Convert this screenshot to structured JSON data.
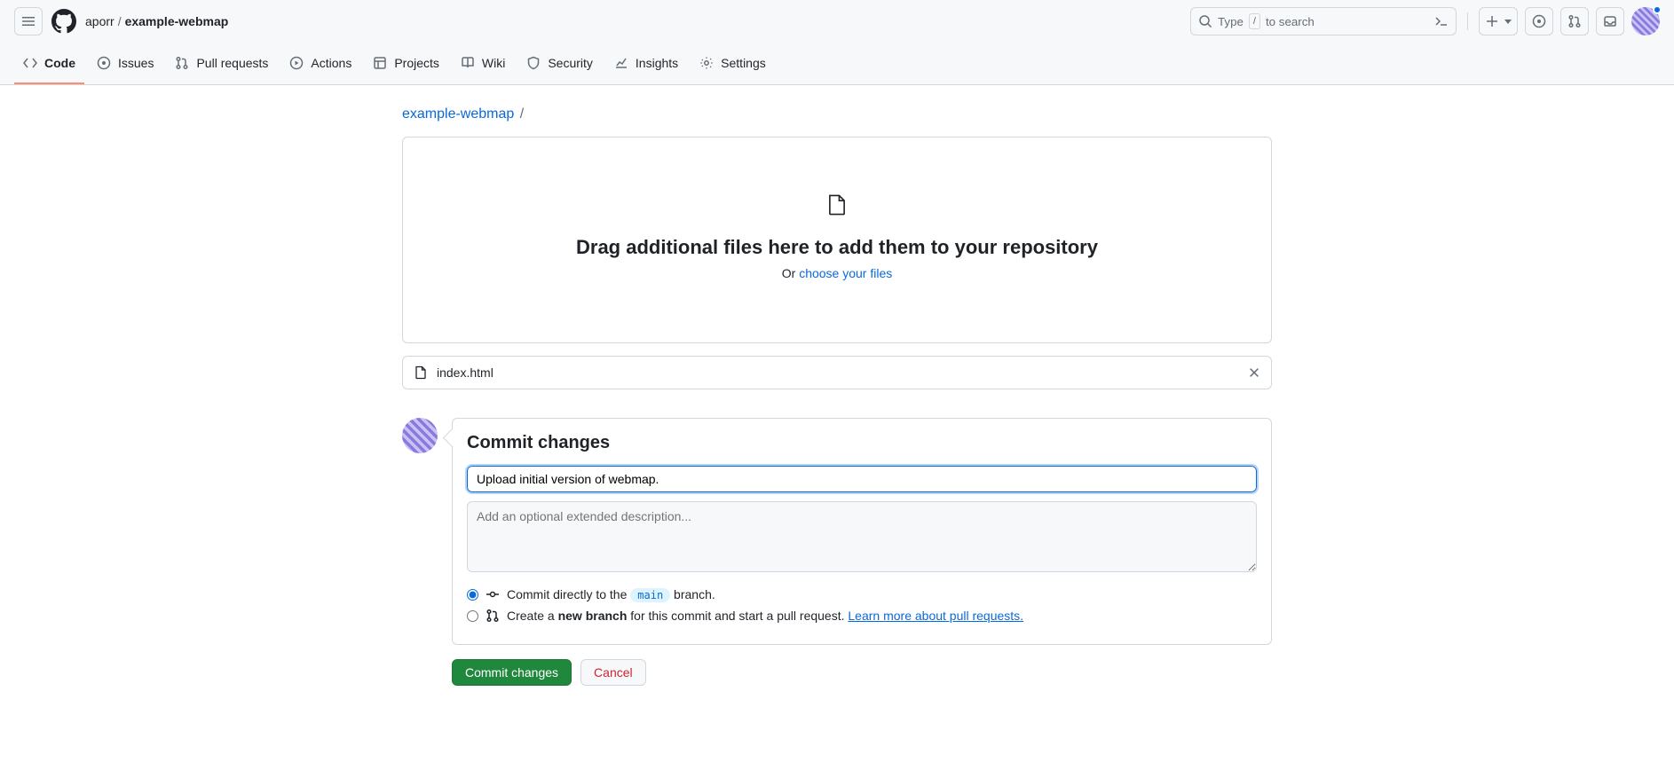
{
  "header": {
    "owner": "aporr",
    "repo": "example-webmap",
    "search_placeholder": "Type",
    "search_suffix": "to search",
    "search_key": "/"
  },
  "tabs": {
    "code": "Code",
    "issues": "Issues",
    "pulls": "Pull requests",
    "actions": "Actions",
    "projects": "Projects",
    "wiki": "Wiki",
    "security": "Security",
    "insights": "Insights",
    "settings": "Settings"
  },
  "path": {
    "repo": "example-webmap",
    "sep": "/"
  },
  "dropzone": {
    "title": "Drag additional files here to add them to your repository",
    "or": "Or ",
    "choose": "choose your files"
  },
  "file": {
    "name": "index.html"
  },
  "commit": {
    "heading": "Commit changes",
    "summary_value": "Upload initial version of webmap.",
    "desc_placeholder": "Add an optional extended description...",
    "direct_prefix": "Commit directly to the ",
    "direct_branch": "main",
    "direct_suffix": " branch.",
    "branch_prefix": "Create a ",
    "branch_bold": "new branch",
    "branch_suffix": " for this commit and start a pull request. ",
    "branch_link": "Learn more about pull requests.",
    "submit": "Commit changes",
    "cancel": "Cancel"
  }
}
